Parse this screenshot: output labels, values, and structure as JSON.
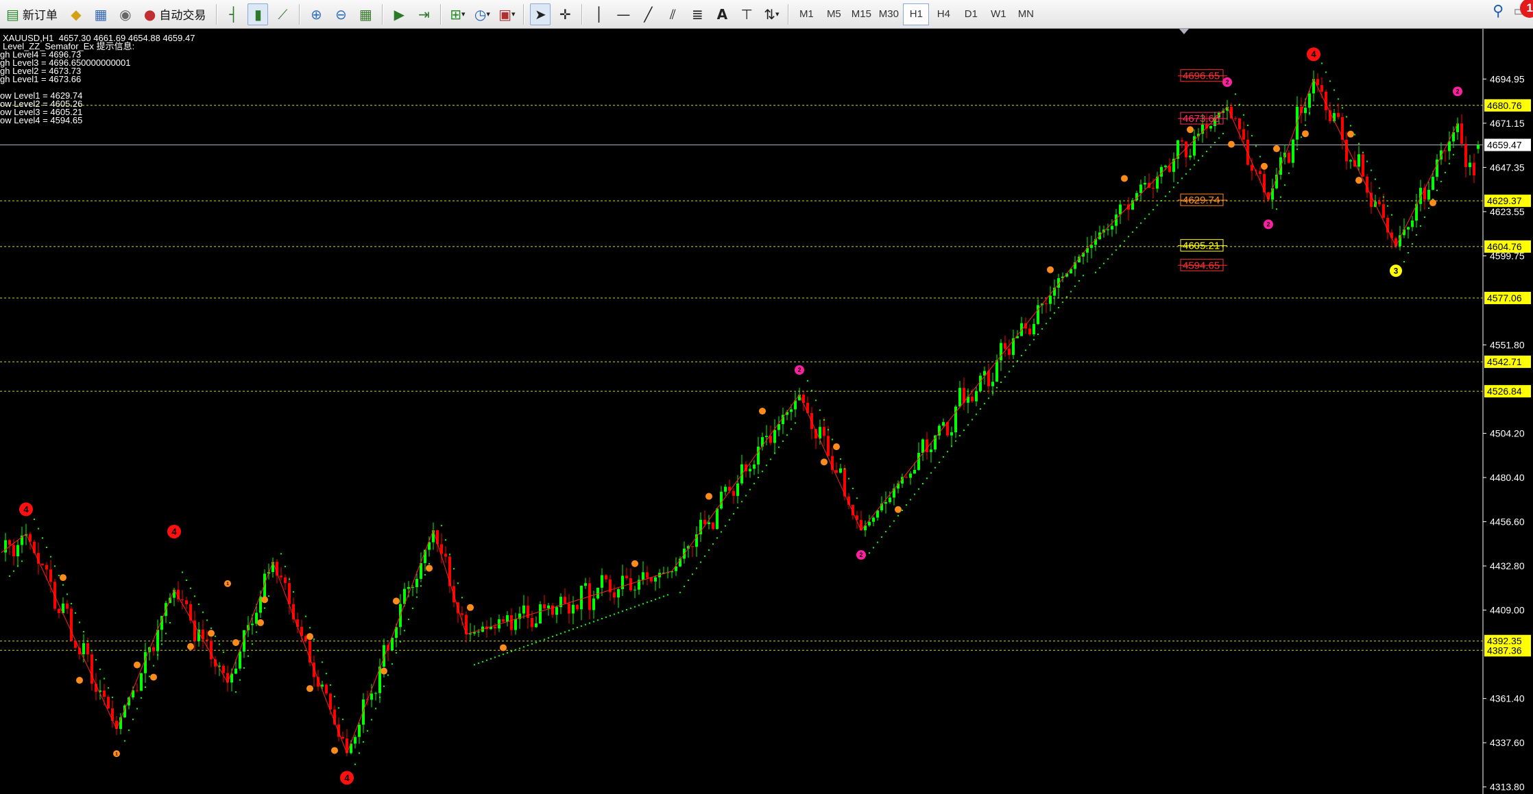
{
  "toolbar": {
    "new_order_label": "新订单",
    "auto_trade_label": "自动交易",
    "timeframes": [
      "M1",
      "M5",
      "M15",
      "M30",
      "H1",
      "H4",
      "D1",
      "W1",
      "MN"
    ],
    "active_timeframe": "H1",
    "notification_count": "1",
    "icons": [
      "new-order-icon",
      "gold-icon",
      "print-icon",
      "signal-icon",
      "auto-trade-icon",
      "bar-chart-icon",
      "candle-chart-icon",
      "line-chart-icon",
      "zoom-in-icon",
      "zoom-out-icon",
      "tile-windows-icon",
      "autoscroll-icon",
      "chart-shift-icon",
      "indicators-icon",
      "periods-icon",
      "templates-icon",
      "cursor-icon",
      "crosshair-icon",
      "vertical-line-icon",
      "horizontal-line-icon",
      "trendline-icon",
      "equidistant-channel-icon",
      "fibonacci-icon",
      "text-icon",
      "text-label-icon",
      "arrows-icon",
      "search-icon",
      "chat-icon"
    ]
  },
  "info": {
    "symbol_line": "XAUUSD,H1  4657.30 4661.69 4654.88 4659.47",
    "indicator_line": "Level_ZZ_Semafor_Ex 提示信息:",
    "high_levels": [
      "gh Level4 = 4696.73",
      "gh Level3 = 4696.650000000001",
      "gh Level2 = 4673.73",
      "gh Level1 = 4673.66"
    ],
    "low_levels": [
      "ow Level1 = 4629.74",
      "ow Level2 = 4605.26",
      "ow Level3 = 4605.21",
      "ow Level4 = 4594.65"
    ]
  },
  "chart_data": {
    "type": "candlestick",
    "symbol": "XAUUSD",
    "timeframe": "H1",
    "ohlc_last": {
      "open": 4657.3,
      "high": 4661.69,
      "low": 4654.88,
      "close": 4659.47
    },
    "current_price": "4659.47",
    "ylim": [
      4310,
      4722
    ],
    "y_ticks": [
      "4694.95",
      "4671.15",
      "4647.35",
      "4623.55",
      "4599.75",
      "4551.80",
      "4504.20",
      "4480.40",
      "4456.60",
      "4432.80",
      "4409.00",
      "4361.40",
      "4337.60",
      "4313.80"
    ],
    "horizontal_levels": [
      {
        "price": 4680.76,
        "label": "4680.76"
      },
      {
        "price": 4629.37,
        "label": "4629.37"
      },
      {
        "price": 4604.76,
        "label": "4604.76"
      },
      {
        "price": 4577.06,
        "label": "4577.06"
      },
      {
        "price": 4542.71,
        "label": "4542.71"
      },
      {
        "price": 4526.84,
        "label": "4526.84"
      },
      {
        "price": 4392.35,
        "label": "4392.35"
      },
      {
        "price": 4387.36,
        "label": "4387.36"
      }
    ],
    "right_level_labels": [
      {
        "price": 4696.65,
        "label": "4696.65",
        "color": "#ff3030"
      },
      {
        "price": 4673.66,
        "label": "4673.66",
        "color": "#ff3060"
      },
      {
        "price": 4629.74,
        "label": "4629.74",
        "color": "#ff8a20"
      },
      {
        "price": 4605.21,
        "label": "4605.21",
        "color": "#ffff00"
      },
      {
        "price": 4594.65,
        "label": "4594.65",
        "color": "#ff3030"
      }
    ],
    "zigzag": [
      [
        0,
        4440
      ],
      [
        6,
        4450
      ],
      [
        28,
        4345
      ],
      [
        42,
        4420
      ],
      [
        55,
        4370
      ],
      [
        66,
        4435
      ],
      [
        72,
        4400
      ],
      [
        84,
        4332
      ],
      [
        105,
        4452
      ],
      [
        113,
        4396
      ],
      [
        163,
        4430
      ],
      [
        194,
        4525
      ],
      [
        209,
        4452
      ],
      [
        264,
        4604
      ],
      [
        298,
        4680
      ],
      [
        308,
        4630
      ],
      [
        319,
        4695
      ],
      [
        339,
        4605
      ],
      [
        354,
        4671
      ]
    ],
    "semafor": [
      {
        "i": 6,
        "level": 4,
        "pos": "above",
        "price": 4450
      },
      {
        "i": 28,
        "level": 1,
        "pos": "below",
        "price": 4345
      },
      {
        "i": 42,
        "level": 4,
        "pos": "above",
        "price": 4438
      },
      {
        "i": 55,
        "level": 1,
        "pos": "above",
        "price": 4410
      },
      {
        "i": 84,
        "level": 4,
        "pos": "below",
        "price": 4332
      },
      {
        "i": 194,
        "level": 2,
        "pos": "above",
        "price": 4525
      },
      {
        "i": 209,
        "level": 2,
        "pos": "below",
        "price": 4452
      },
      {
        "i": 298,
        "level": 2,
        "pos": "above",
        "price": 4680
      },
      {
        "i": 308,
        "level": 2,
        "pos": "below",
        "price": 4630
      },
      {
        "i": 319,
        "level": 4,
        "pos": "above",
        "price": 4695
      },
      {
        "i": 339,
        "level": 3,
        "pos": "below",
        "price": 4605
      },
      {
        "i": 354,
        "level": 2,
        "pos": "above",
        "price": 4675
      }
    ],
    "colors": {
      "bull": "#00ff00",
      "bear": "#ff0000",
      "zigzag": "#ff2020",
      "level_line": "#d8d820",
      "price_line": "#b0b0c0",
      "sar": "#00ff00",
      "tag_bg": "#ffff00",
      "axis_text": "#ffffff"
    }
  }
}
